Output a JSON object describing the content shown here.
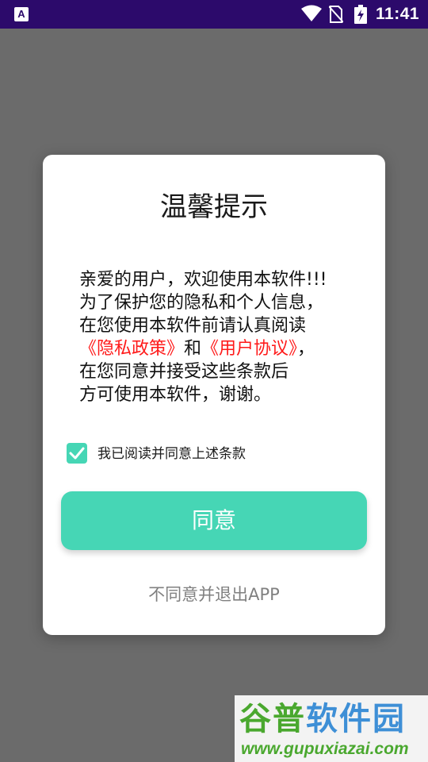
{
  "status_bar": {
    "left_icon_label": "A",
    "time": "11:41"
  },
  "dialog": {
    "title": "温馨提示",
    "body": {
      "line1": "亲爱的用户，欢迎使用本软件!!!",
      "line2": "为了保护您的隐私和个人信息，",
      "line3": "在您使用本软件前请认真阅读",
      "privacy_link": "《隐私政策》",
      "and": "和",
      "agreement_link": "《用户协议》",
      "line4_tail": "，",
      "line5": "在您同意并接受这些条款后",
      "line6": "方可使用本软件，谢谢。"
    },
    "checkbox_label": "我已阅读并同意上述条款",
    "checkbox_checked": true,
    "agree_button": "同意",
    "exit_link": "不同意并退出APP"
  },
  "watermark": {
    "logo_part1": "谷普",
    "logo_part2": "软件园",
    "url": "www.gupuxiazai.com"
  },
  "colors": {
    "accent": "#46d6b5",
    "link": "#ff1a1a",
    "status_bar": "#2c0a6b",
    "overlay": "#6b6b6b"
  }
}
